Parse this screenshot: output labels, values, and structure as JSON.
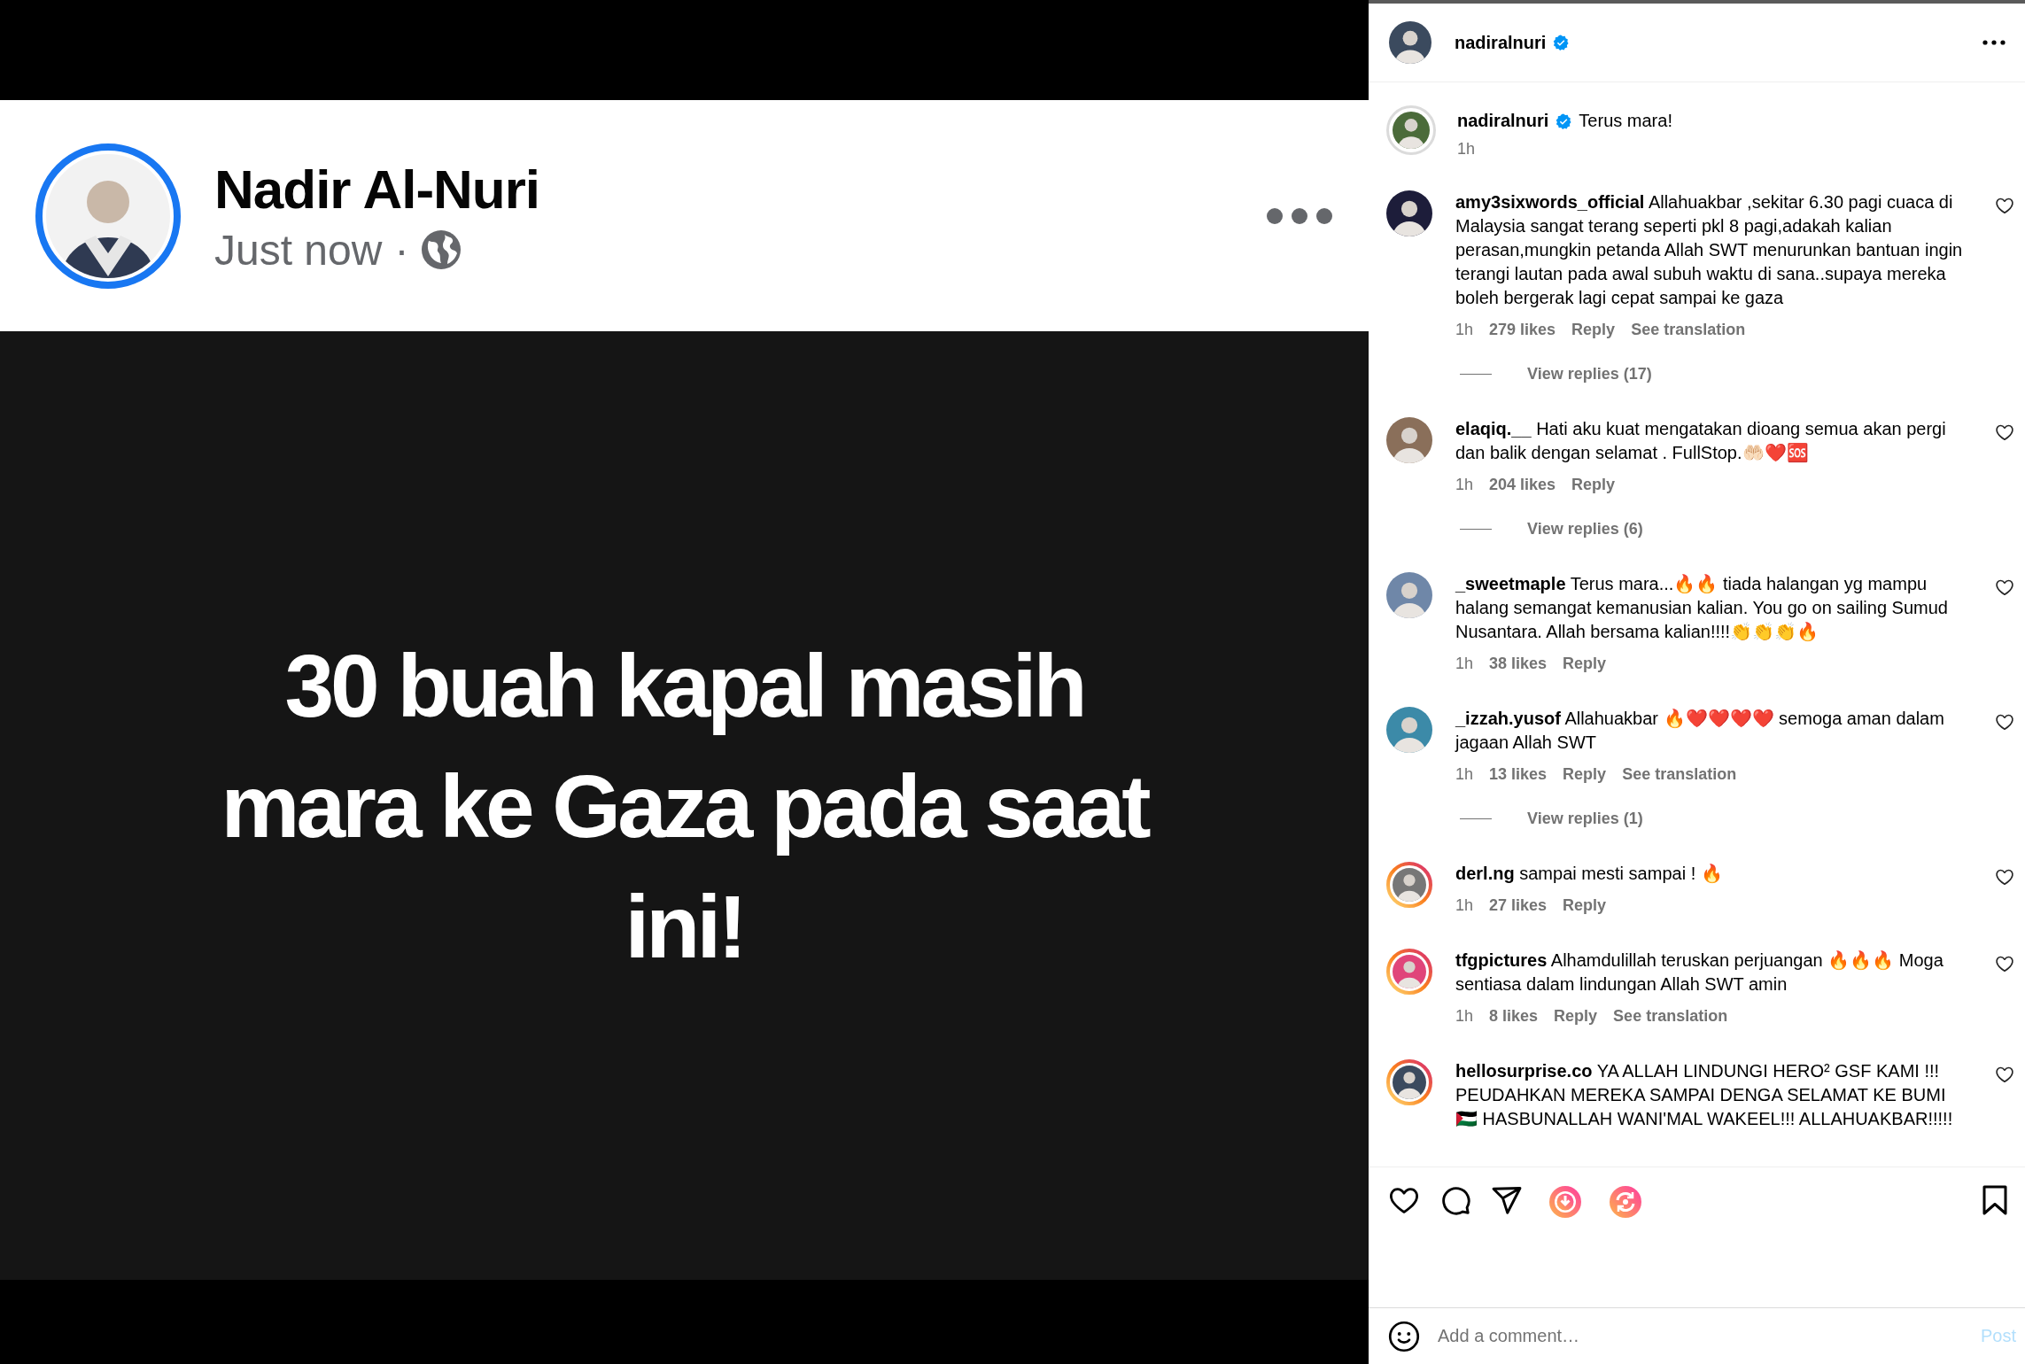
{
  "media": {
    "author": "Nadir Al-Nuri",
    "time": "Just now",
    "separator": "·",
    "body": "30 buah kapal masih mara ke Gaza pada saat ini!"
  },
  "header": {
    "username": "nadiralnuri",
    "verified": true
  },
  "caption": {
    "username": "nadiralnuri",
    "verified": true,
    "text": "Terus mara!",
    "time": "1h",
    "story_ring": true,
    "story_seen": true
  },
  "comments": [
    {
      "username": "amy3sixwords_official",
      "text": "Allahuakbar ,sekitar 6.30 pagi cuaca di Malaysia sangat terang seperti pkl 8 pagi,adakah kalian perasan,mungkin petanda Allah SWT menurunkan bantuan ingin terangi lautan pada awal subuh waktu di sana..supaya mereka boleh bergerak lagi cepat sampai ke gaza",
      "time": "1h",
      "likes": "279 likes",
      "reply": "Reply",
      "translation": "See translation",
      "view_replies": "View replies (17)",
      "liked": false,
      "story_ring": false
    },
    {
      "username": "elaqiq.__",
      "text": "Hati aku kuat mengatakan dioang semua akan pergi dan balik dengan selamat . FullStop.🤲🏻❤️🆘",
      "time": "1h",
      "likes": "204 likes",
      "reply": "Reply",
      "view_replies": "View replies (6)",
      "liked": false,
      "story_ring": false
    },
    {
      "username": "_sweetmaple",
      "text": "Terus mara...🔥🔥 tiada halangan yg mampu halang semangat kemanusian kalian. You go on sailing Sumud Nusantara. Allah bersama kalian!!!!👏👏👏🔥",
      "time": "1h",
      "likes": "38 likes",
      "reply": "Reply",
      "liked": false,
      "story_ring": false
    },
    {
      "username": "_izzah.yusof",
      "text": "Allahuakbar 🔥❤️❤️❤️❤️ semoga aman dalam jagaan Allah SWT",
      "time": "1h",
      "likes": "13 likes",
      "reply": "Reply",
      "translation": "See translation",
      "view_replies": "View replies (1)",
      "liked": false,
      "story_ring": false
    },
    {
      "username": "derl.ng",
      "text": "sampai mesti sampai ! 🔥",
      "time": "1h",
      "likes": "27 likes",
      "reply": "Reply",
      "liked": false,
      "story_ring": true,
      "story_seen": false
    },
    {
      "username": "tfgpictures",
      "text": "Alhamdulillah teruskan perjuangan 🔥🔥🔥 Moga sentiasa dalam lindungan Allah SWT amin",
      "time": "1h",
      "likes": "8 likes",
      "reply": "Reply",
      "translation": "See translation",
      "liked": false,
      "story_ring": true,
      "story_seen": false
    },
    {
      "username": "hellosurprise.co",
      "text": "YA ALLAH LINDUNGI HERO² GSF KAMI !!! PEUDAHKAN MEREKA SAMPAI DENGA SELAMAT KE BUMI 🇵🇸 HASBUNALLAH WANI'MAL WAKEEL!!! ALLAHUAKBAR!!!!!",
      "liked": false,
      "story_ring": true,
      "story_seen": false
    }
  ],
  "actions": {
    "liked": false,
    "saved": false
  },
  "comment_field": {
    "placeholder": "Add a comment…",
    "post": "Post",
    "post_enabled": false
  }
}
